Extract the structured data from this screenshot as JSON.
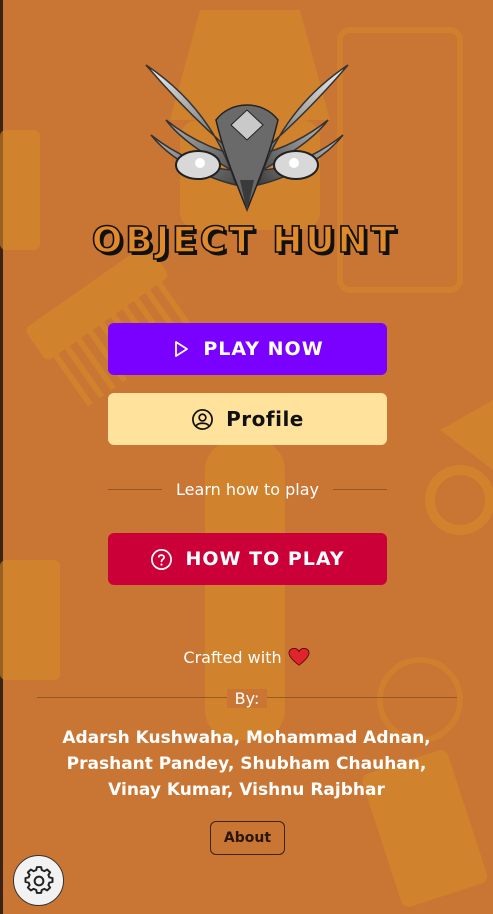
{
  "app": {
    "title": "OBJECT HUNT"
  },
  "buttons": {
    "play_label": "PLAY NOW",
    "profile_label": "Profile",
    "how_label": "HOW TO PLAY",
    "about_label": "About"
  },
  "divider": {
    "learn_text": "Learn how to play"
  },
  "credits": {
    "crafted_with": "Crafted with",
    "by": "By:",
    "authors_line1": "Adarsh Kushwaha, Mohammad Adnan,",
    "authors_line2": "Prashant Pandey, Shubham Chauhan,",
    "authors_line3": "Vinay Kumar, Vishnu Rajbhar"
  },
  "icons": {
    "play": "play-icon",
    "profile": "user-circle-icon",
    "help": "question-circle-icon",
    "heart": "heart-icon",
    "settings": "gear-icon"
  },
  "colors": {
    "background": "#c97533",
    "play": "#7a00ff",
    "profile": "#ffe29c",
    "how": "#cc0039",
    "heart": "#e0242c"
  }
}
